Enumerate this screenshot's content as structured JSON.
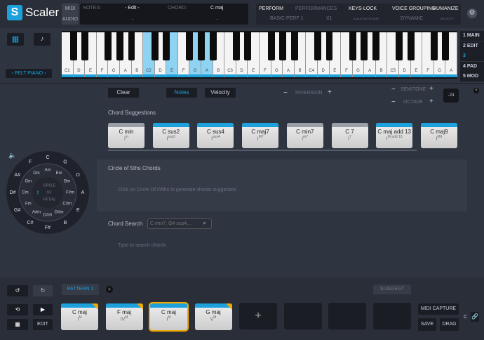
{
  "app": {
    "title": "Scaler",
    "logo": "S"
  },
  "header": {
    "midi": "MIDI",
    "audio": "AUDIO",
    "notes_label": "NOTES:",
    "notes_value": "- Edit -",
    "notes_sub": ".",
    "chord_label": "CHORD:",
    "chord_value": "C maj",
    "chord_sub": ".",
    "perform": "PERFORM",
    "performances": "PERFORMANCES",
    "perf_value": "BASIC PERF 1",
    "perf_mult": "X1",
    "keys_lock": "KEYS-LOCK",
    "keys_lock_value": "SCALE NOTES MAP",
    "voice_grouping": "VOICE GROUPING",
    "voice_value": "DYNAMIC",
    "humanize": "HUMANIZE",
    "humanize_value": "VELOCITY"
  },
  "instrument": {
    "name": "FELT PIANO"
  },
  "keyboard": {
    "white_keys": [
      "C1",
      "D",
      "E",
      "F",
      "G",
      "A",
      "B",
      "C2",
      "D",
      "E",
      "F",
      "G",
      "A",
      "B",
      "C3",
      "D",
      "E",
      "F",
      "G",
      "A",
      "B",
      "C4",
      "D",
      "E",
      "F",
      "G",
      "A",
      "B",
      "C5",
      "D",
      "E",
      "F",
      "G",
      "A"
    ],
    "highlighted": [
      7,
      9,
      11,
      12
    ],
    "accent": "#1da1dc"
  },
  "tabs": [
    {
      "label": "1 MAIN"
    },
    {
      "label": "2 EDIT"
    },
    {
      "label": "3 CHORD",
      "active": true
    },
    {
      "label": "4 PAD"
    },
    {
      "label": "5 MOD"
    }
  ],
  "controls": {
    "clear": "Clear",
    "notes": "Notes",
    "velocity": "Velocity",
    "inversion": "INVERSION",
    "semitone": "SEMITONE",
    "octave": "OCTAVE",
    "minus": "−",
    "plus": "+",
    "transpose_value": "-24"
  },
  "suggestions": {
    "title": "Chord Suggestions",
    "chords": [
      {
        "name": "C min",
        "roman": "i",
        "sup": "m",
        "grey": true
      },
      {
        "name": "C sus2",
        "roman": "I",
        "sup": "sus2"
      },
      {
        "name": "C sus4",
        "roman": "I",
        "sup": "sus4"
      },
      {
        "name": "C maj7",
        "roman": "I",
        "sup": "M7"
      },
      {
        "name": "C min7",
        "roman": "i",
        "sup": "m7",
        "grey": true
      },
      {
        "name": "C 7",
        "roman": "I",
        "sup": "7",
        "grey": true
      },
      {
        "name": "C maj add 13",
        "roman": "I",
        "sup": "M add 13"
      },
      {
        "name": "C maj9",
        "roman": "I",
        "sup": "M9"
      }
    ]
  },
  "circle": {
    "center": [
      "CIRCLE",
      "OF",
      "FIFTHS"
    ],
    "natural_symbol": "♮",
    "outer": [
      "C",
      "G",
      "D",
      "A",
      "E",
      "B",
      "F#",
      "C#",
      "G#",
      "D#",
      "A#",
      "F"
    ],
    "inner": [
      "Am",
      "Em",
      "Bm",
      "F#m",
      "C#m",
      "G#m",
      "D#m",
      "A#m",
      "Fm",
      "Cm",
      "Gm",
      "Dm"
    ]
  },
  "circle_section": {
    "title": "Circle of 5ths Chords",
    "hint": "Click on Circle Of Fifths to generate chords suggestion"
  },
  "search": {
    "label": "Chord Search",
    "placeholder": "C min7, G# sus4,...",
    "hint": "Type to search chords"
  },
  "pattern": {
    "tab": "PATTERN 1",
    "suggest": "SUGGEST",
    "edit": "EDIT",
    "midi_capture": "MIDI CAPTURE",
    "save": "SAVE",
    "drag": "DRAG",
    "key": "C",
    "chords": [
      {
        "name": "C maj",
        "roman": "I",
        "sup": "M"
      },
      {
        "name": "F maj",
        "roman": "IV",
        "sup": "M"
      },
      {
        "name": "C maj",
        "roman": "I",
        "sup": "M",
        "selected": true
      },
      {
        "name": "G maj",
        "roman": "V",
        "sup": "M"
      }
    ],
    "add": "+"
  }
}
